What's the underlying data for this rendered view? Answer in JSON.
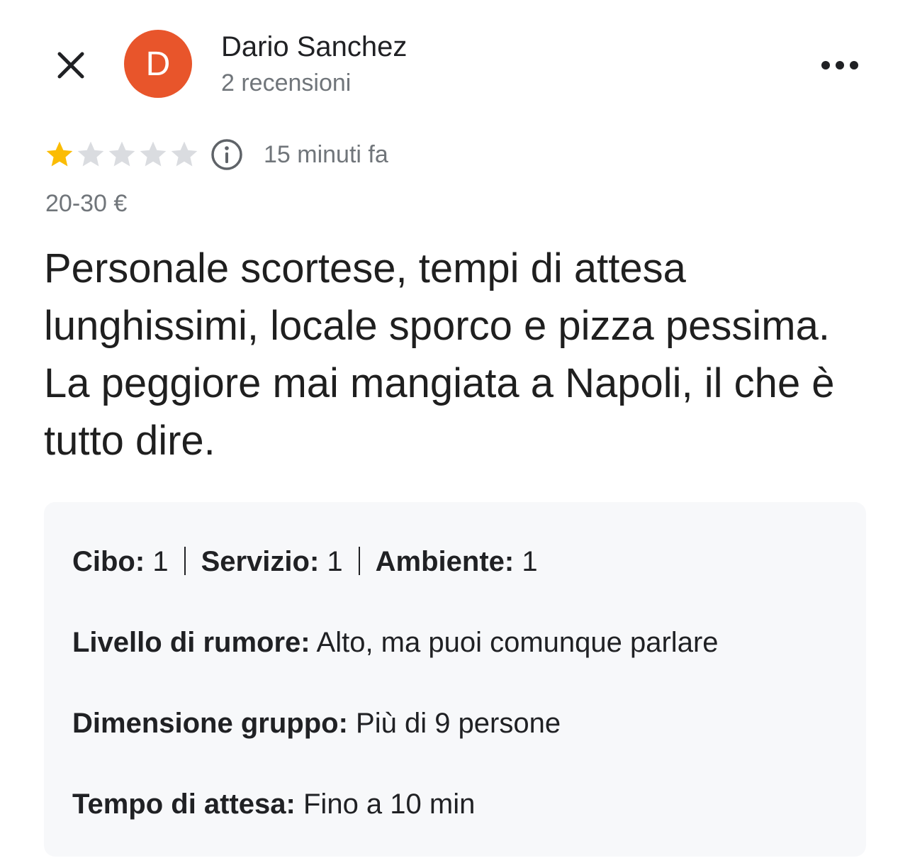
{
  "header": {
    "avatar_letter": "D",
    "avatar_color": "#e8552b",
    "author_name": "Dario Sanchez",
    "author_reviews": "2 recensioni",
    "close_icon": "close-icon",
    "more_icon": "more-horizontal-icon"
  },
  "rating": {
    "stars_filled": 1,
    "stars_total": 5,
    "star_filled_color": "#fbbc04",
    "star_empty_color": "#dadce0",
    "time_ago": "15 minuti fa",
    "price_range": "20-30 €"
  },
  "review": {
    "text": "Personale scortese, tempi di attesa lunghissimi, locale sporco e pizza pessima. La peggiore mai mangiata a Napoli, il che è tutto dire."
  },
  "details": {
    "cibo_label": "Cibo:",
    "cibo_value": "1",
    "servizio_label": "Servizio:",
    "servizio_value": "1",
    "ambiente_label": "Ambiente:",
    "ambiente_value": "1",
    "rumore_label": "Livello di rumore:",
    "rumore_value": "Alto, ma puoi comunque parlare",
    "gruppo_label": "Dimensione gruppo:",
    "gruppo_value": "Più di 9 persone",
    "attesa_label": "Tempo di attesa:",
    "attesa_value": "Fino a 10 min"
  }
}
